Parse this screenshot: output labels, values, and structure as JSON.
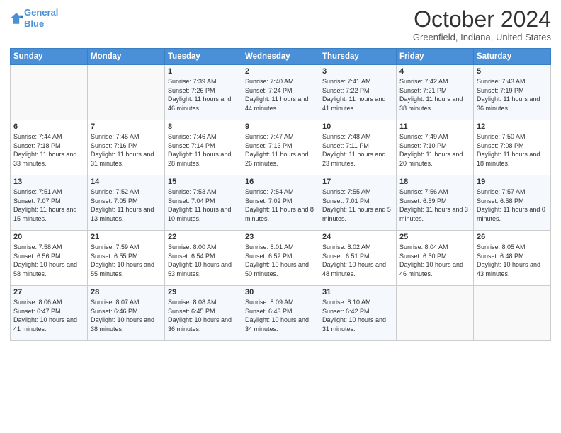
{
  "logo": {
    "line1": "General",
    "line2": "Blue"
  },
  "header": {
    "title": "October 2024",
    "location": "Greenfield, Indiana, United States"
  },
  "days_of_week": [
    "Sunday",
    "Monday",
    "Tuesday",
    "Wednesday",
    "Thursday",
    "Friday",
    "Saturday"
  ],
  "weeks": [
    [
      {
        "num": "",
        "detail": ""
      },
      {
        "num": "",
        "detail": ""
      },
      {
        "num": "1",
        "detail": "Sunrise: 7:39 AM\nSunset: 7:26 PM\nDaylight: 11 hours and 46 minutes."
      },
      {
        "num": "2",
        "detail": "Sunrise: 7:40 AM\nSunset: 7:24 PM\nDaylight: 11 hours and 44 minutes."
      },
      {
        "num": "3",
        "detail": "Sunrise: 7:41 AM\nSunset: 7:22 PM\nDaylight: 11 hours and 41 minutes."
      },
      {
        "num": "4",
        "detail": "Sunrise: 7:42 AM\nSunset: 7:21 PM\nDaylight: 11 hours and 38 minutes."
      },
      {
        "num": "5",
        "detail": "Sunrise: 7:43 AM\nSunset: 7:19 PM\nDaylight: 11 hours and 36 minutes."
      }
    ],
    [
      {
        "num": "6",
        "detail": "Sunrise: 7:44 AM\nSunset: 7:18 PM\nDaylight: 11 hours and 33 minutes."
      },
      {
        "num": "7",
        "detail": "Sunrise: 7:45 AM\nSunset: 7:16 PM\nDaylight: 11 hours and 31 minutes."
      },
      {
        "num": "8",
        "detail": "Sunrise: 7:46 AM\nSunset: 7:14 PM\nDaylight: 11 hours and 28 minutes."
      },
      {
        "num": "9",
        "detail": "Sunrise: 7:47 AM\nSunset: 7:13 PM\nDaylight: 11 hours and 26 minutes."
      },
      {
        "num": "10",
        "detail": "Sunrise: 7:48 AM\nSunset: 7:11 PM\nDaylight: 11 hours and 23 minutes."
      },
      {
        "num": "11",
        "detail": "Sunrise: 7:49 AM\nSunset: 7:10 PM\nDaylight: 11 hours and 20 minutes."
      },
      {
        "num": "12",
        "detail": "Sunrise: 7:50 AM\nSunset: 7:08 PM\nDaylight: 11 hours and 18 minutes."
      }
    ],
    [
      {
        "num": "13",
        "detail": "Sunrise: 7:51 AM\nSunset: 7:07 PM\nDaylight: 11 hours and 15 minutes."
      },
      {
        "num": "14",
        "detail": "Sunrise: 7:52 AM\nSunset: 7:05 PM\nDaylight: 11 hours and 13 minutes."
      },
      {
        "num": "15",
        "detail": "Sunrise: 7:53 AM\nSunset: 7:04 PM\nDaylight: 11 hours and 10 minutes."
      },
      {
        "num": "16",
        "detail": "Sunrise: 7:54 AM\nSunset: 7:02 PM\nDaylight: 11 hours and 8 minutes."
      },
      {
        "num": "17",
        "detail": "Sunrise: 7:55 AM\nSunset: 7:01 PM\nDaylight: 11 hours and 5 minutes."
      },
      {
        "num": "18",
        "detail": "Sunrise: 7:56 AM\nSunset: 6:59 PM\nDaylight: 11 hours and 3 minutes."
      },
      {
        "num": "19",
        "detail": "Sunrise: 7:57 AM\nSunset: 6:58 PM\nDaylight: 11 hours and 0 minutes."
      }
    ],
    [
      {
        "num": "20",
        "detail": "Sunrise: 7:58 AM\nSunset: 6:56 PM\nDaylight: 10 hours and 58 minutes."
      },
      {
        "num": "21",
        "detail": "Sunrise: 7:59 AM\nSunset: 6:55 PM\nDaylight: 10 hours and 55 minutes."
      },
      {
        "num": "22",
        "detail": "Sunrise: 8:00 AM\nSunset: 6:54 PM\nDaylight: 10 hours and 53 minutes."
      },
      {
        "num": "23",
        "detail": "Sunrise: 8:01 AM\nSunset: 6:52 PM\nDaylight: 10 hours and 50 minutes."
      },
      {
        "num": "24",
        "detail": "Sunrise: 8:02 AM\nSunset: 6:51 PM\nDaylight: 10 hours and 48 minutes."
      },
      {
        "num": "25",
        "detail": "Sunrise: 8:04 AM\nSunset: 6:50 PM\nDaylight: 10 hours and 46 minutes."
      },
      {
        "num": "26",
        "detail": "Sunrise: 8:05 AM\nSunset: 6:48 PM\nDaylight: 10 hours and 43 minutes."
      }
    ],
    [
      {
        "num": "27",
        "detail": "Sunrise: 8:06 AM\nSunset: 6:47 PM\nDaylight: 10 hours and 41 minutes."
      },
      {
        "num": "28",
        "detail": "Sunrise: 8:07 AM\nSunset: 6:46 PM\nDaylight: 10 hours and 38 minutes."
      },
      {
        "num": "29",
        "detail": "Sunrise: 8:08 AM\nSunset: 6:45 PM\nDaylight: 10 hours and 36 minutes."
      },
      {
        "num": "30",
        "detail": "Sunrise: 8:09 AM\nSunset: 6:43 PM\nDaylight: 10 hours and 34 minutes."
      },
      {
        "num": "31",
        "detail": "Sunrise: 8:10 AM\nSunset: 6:42 PM\nDaylight: 10 hours and 31 minutes."
      },
      {
        "num": "",
        "detail": ""
      },
      {
        "num": "",
        "detail": ""
      }
    ]
  ]
}
